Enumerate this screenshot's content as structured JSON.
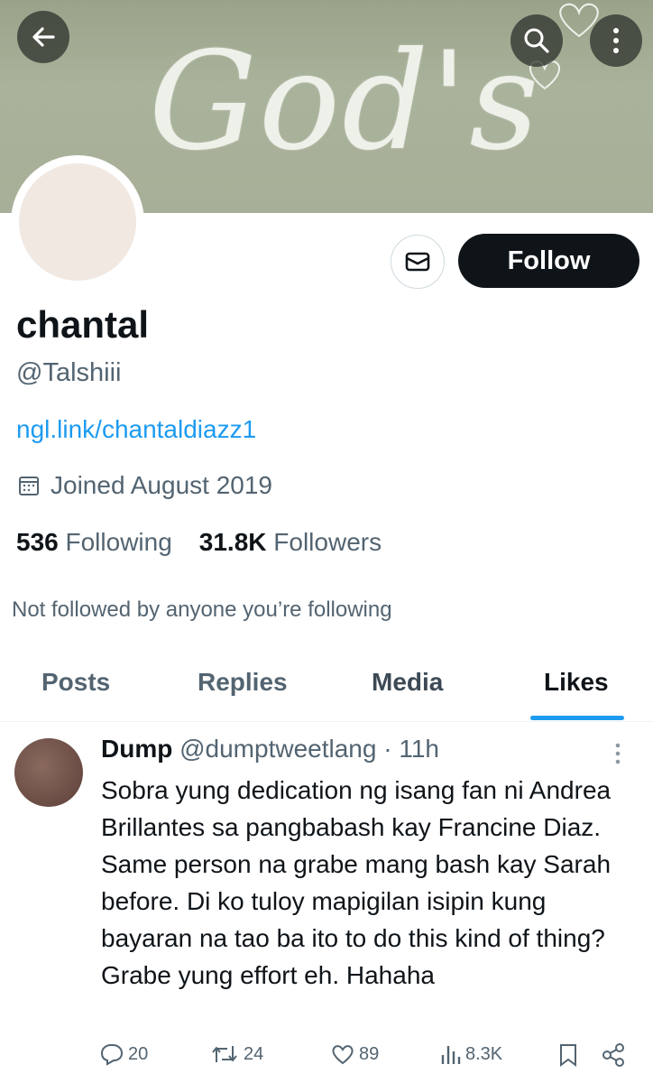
{
  "banner": {
    "script_text": "God's"
  },
  "profile": {
    "display_name": "chantal",
    "handle": "@Talshiii",
    "link": "ngl.link/chantaldiazz1",
    "joined": "Joined August 2019",
    "following_count": "536",
    "following_label": "Following",
    "followers_count": "31.8K",
    "followers_label": "Followers",
    "not_followed": "Not followed by anyone you’re following"
  },
  "buttons": {
    "follow_label": "Follow"
  },
  "tabs": [
    {
      "label": "Posts"
    },
    {
      "label": "Replies"
    },
    {
      "label": "Media"
    },
    {
      "label": "Likes",
      "active": true
    }
  ],
  "tweet": {
    "author_name": "Dump",
    "author_handle": "@dumptweetlang",
    "separator": "·",
    "time": "11h",
    "text": "Sobra yung dedication ng isang fan ni Andrea Brillantes sa pangbabash kay Francine Diaz. Same person na grabe mang bash kay Sarah before. Di ko tuloy mapigilan isipin kung bayaran na tao ba ito to do this kind of thing? Grabe yung effort eh. Hahaha",
    "replies": "20",
    "retweets": "24",
    "likes": "89",
    "views": "8.3K"
  },
  "colors": {
    "accent": "#1d9bf0",
    "text": "#0f1419",
    "muted": "#536471",
    "banner": "#a7af98"
  },
  "icons": [
    "back-arrow-icon",
    "search-icon",
    "more-vertical-icon",
    "mail-icon",
    "calendar-icon",
    "reply-icon",
    "retweet-icon",
    "heart-icon",
    "views-icon",
    "bookmark-icon",
    "share-icon"
  ]
}
